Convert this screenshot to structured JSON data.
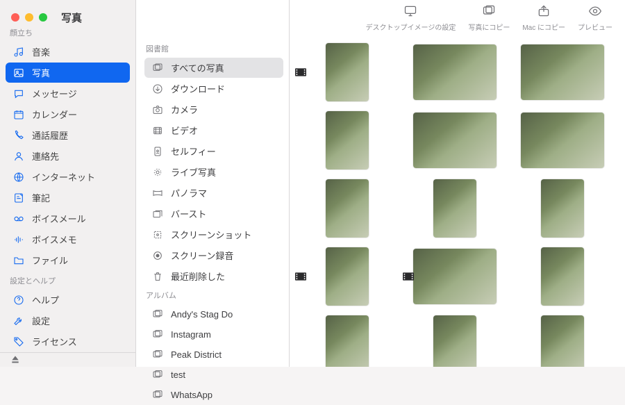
{
  "app_title": "写真",
  "toolbar": [
    {
      "key": "set-desktop",
      "label": "デスクトップイメージの設定",
      "icon": "desktop-icon"
    },
    {
      "key": "copy-photos",
      "label": "写真にコピー",
      "icon": "photos-icon"
    },
    {
      "key": "copy-mac",
      "label": "Mac にコピー",
      "icon": "export-icon"
    },
    {
      "key": "preview",
      "label": "プレビュー",
      "icon": "eye-icon"
    }
  ],
  "left": {
    "section1_header": "顔立ち",
    "items1": [
      {
        "key": "music",
        "label": "音楽",
        "icon": "music-icon"
      },
      {
        "key": "photos",
        "label": "写真",
        "icon": "photo-icon",
        "active": true
      },
      {
        "key": "messages",
        "label": "メッセージ",
        "icon": "chat-icon"
      },
      {
        "key": "calendar",
        "label": "カレンダー",
        "icon": "calendar-icon"
      },
      {
        "key": "calls",
        "label": "通話履歴",
        "icon": "phone-icon"
      },
      {
        "key": "contacts",
        "label": "連絡先",
        "icon": "person-icon"
      },
      {
        "key": "internet",
        "label": "インターネット",
        "icon": "globe-icon"
      },
      {
        "key": "notes",
        "label": "筆記",
        "icon": "note-icon"
      },
      {
        "key": "voicemail",
        "label": "ボイスメール",
        "icon": "voicemail-icon"
      },
      {
        "key": "voicememo",
        "label": "ボイスメモ",
        "icon": "wave-icon"
      },
      {
        "key": "files",
        "label": "ファイル",
        "icon": "folder-icon"
      }
    ],
    "section2_header": "設定とヘルプ",
    "items2": [
      {
        "key": "help",
        "label": "ヘルプ",
        "icon": "help-icon"
      },
      {
        "key": "settings",
        "label": "設定",
        "icon": "wrench-icon"
      },
      {
        "key": "license",
        "label": "ライセンス",
        "icon": "tag-icon"
      }
    ]
  },
  "library": {
    "header": "図書館",
    "items": [
      {
        "key": "all",
        "label": "すべての写真",
        "icon": "grid-icon",
        "selected": true
      },
      {
        "key": "downloads",
        "label": "ダウンロード",
        "icon": "download-icon"
      },
      {
        "key": "camera",
        "label": "カメラ",
        "icon": "camera-icon"
      },
      {
        "key": "videos",
        "label": "ビデオ",
        "icon": "video-icon"
      },
      {
        "key": "selfies",
        "label": "セルフィー",
        "icon": "selfie-icon"
      },
      {
        "key": "live",
        "label": "ライブ写真",
        "icon": "live-icon"
      },
      {
        "key": "panorama",
        "label": "パノラマ",
        "icon": "pano-icon"
      },
      {
        "key": "burst",
        "label": "バースト",
        "icon": "burst-icon"
      },
      {
        "key": "screenshot",
        "label": "スクリーンショット",
        "icon": "screenshot-icon"
      },
      {
        "key": "screenrec",
        "label": "スクリーン録音",
        "icon": "record-icon"
      },
      {
        "key": "trash",
        "label": "最近削除した",
        "icon": "trash-icon"
      }
    ]
  },
  "albums": {
    "header": "アルバム",
    "items": [
      {
        "key": "a1",
        "label": "Andy's Stag Do",
        "icon": "album-icon"
      },
      {
        "key": "a2",
        "label": "Instagram",
        "icon": "album-icon"
      },
      {
        "key": "a3",
        "label": "Peak District",
        "icon": "album-icon"
      },
      {
        "key": "a4",
        "label": "test",
        "icon": "album-icon"
      },
      {
        "key": "a5",
        "label": "WhatsApp",
        "icon": "album-icon"
      }
    ]
  },
  "thumbnails": [
    {
      "orient": "portrait",
      "video": true
    },
    {
      "orient": "landscape"
    },
    {
      "orient": "landscape"
    },
    {
      "orient": "portrait"
    },
    {
      "orient": "landscape"
    },
    {
      "orient": "landscape"
    },
    {
      "orient": "portrait"
    },
    {
      "orient": "portrait"
    },
    {
      "orient": "portrait"
    },
    {
      "orient": "portrait",
      "video": true
    },
    {
      "orient": "landscape",
      "video": true
    },
    {
      "orient": "portrait"
    },
    {
      "orient": "portrait"
    },
    {
      "orient": "portrait"
    },
    {
      "orient": "portrait"
    }
  ]
}
